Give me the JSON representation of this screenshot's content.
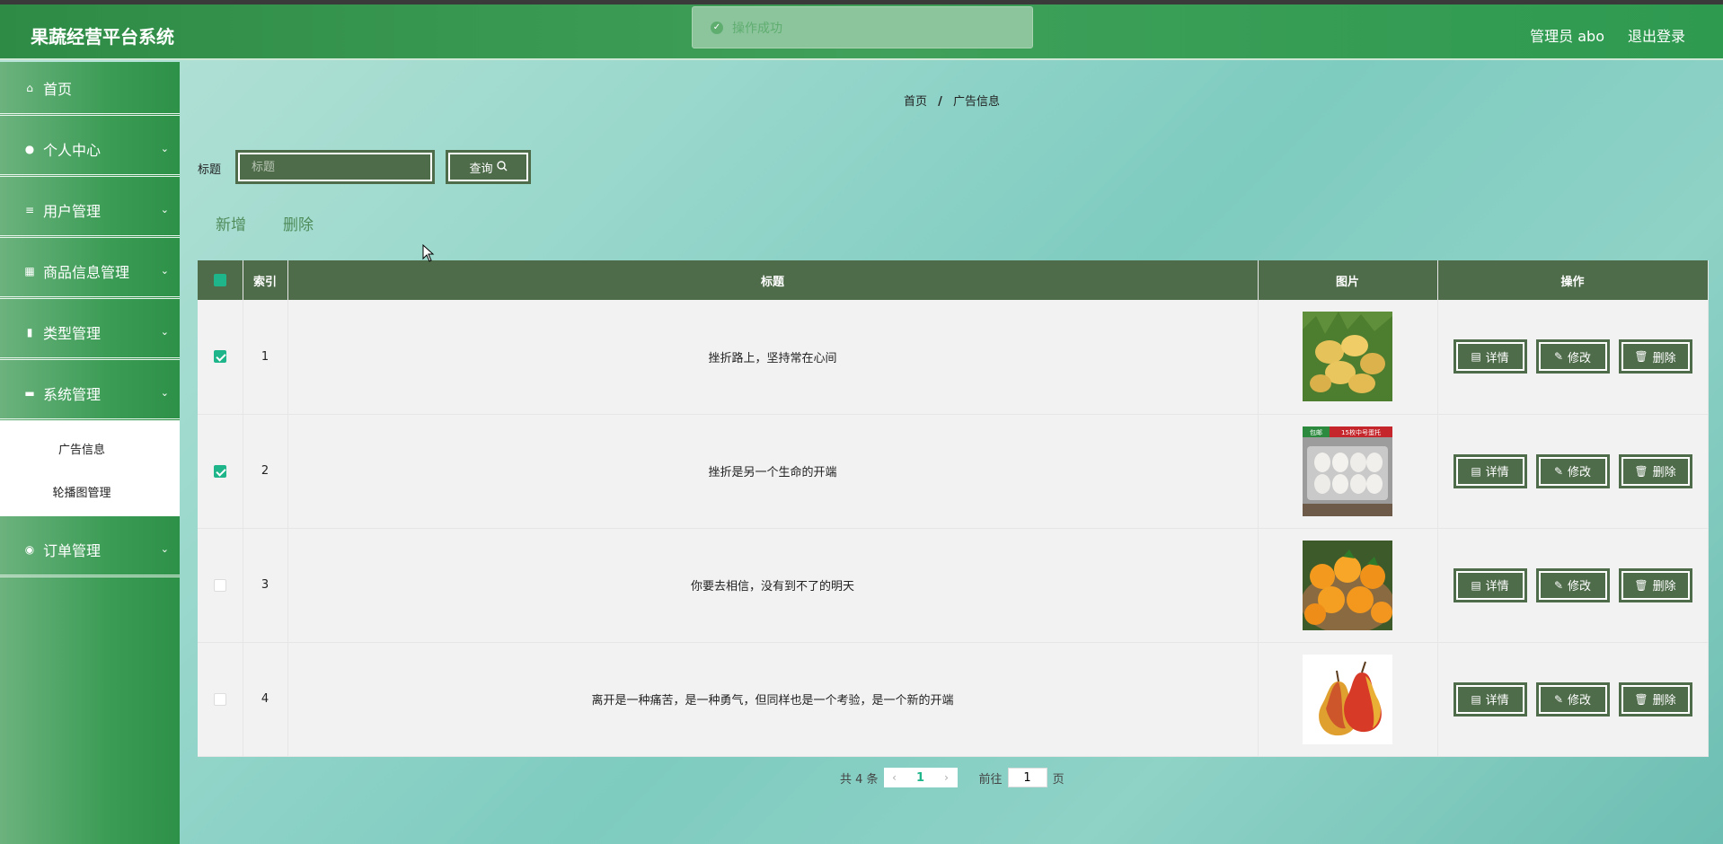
{
  "header": {
    "title": "果蔬经营平台系统",
    "user": "管理员 abo",
    "logout": "退出登录"
  },
  "toast": {
    "message": "操作成功"
  },
  "sidebar": {
    "items": [
      {
        "label": "首页",
        "icon": "home-icon"
      },
      {
        "label": "个人中心",
        "icon": "user-icon"
      },
      {
        "label": "用户管理",
        "icon": "list-icon"
      },
      {
        "label": "商品信息管理",
        "icon": "grid-icon"
      },
      {
        "label": "类型管理",
        "icon": "bar-chart-icon"
      },
      {
        "label": "系统管理",
        "icon": "monitor-icon"
      },
      {
        "label": "订单管理",
        "icon": "location-icon"
      }
    ],
    "sub_items": [
      "广告信息",
      "轮播图管理"
    ]
  },
  "breadcrumb": {
    "home": "首页",
    "sep": "/",
    "current": "广告信息"
  },
  "search": {
    "label": "标题",
    "placeholder": "标题",
    "button": "查询"
  },
  "actions": {
    "add": "新增",
    "delete": "删除"
  },
  "table": {
    "headers": [
      "索引",
      "标题",
      "图片",
      "操作"
    ],
    "rows": [
      {
        "index": "1",
        "title": "挫折路上，坚持常在心间",
        "image": "potatoes",
        "checked": true
      },
      {
        "index": "2",
        "title": "挫折是另一个生命的开端",
        "image": "eggs",
        "checked": true
      },
      {
        "index": "3",
        "title": "你要去相信，没有到不了的明天",
        "image": "oranges",
        "checked": false
      },
      {
        "index": "4",
        "title": "离开是一种痛苦，是一种勇气，但同样也是一个考验，是一个新的开端",
        "image": "pears",
        "checked": false
      }
    ],
    "op_labels": {
      "detail": "详情",
      "edit": "修改",
      "delete": "删除"
    },
    "egg_banner": {
      "left": "包邮",
      "right": "15枚中号蛋托"
    }
  },
  "pagination": {
    "total": "共 4 条",
    "current_page": "1",
    "goto_label": "前往",
    "goto_value": "1",
    "page_suffix": "页"
  },
  "colors": {
    "header": "#3a9a55",
    "button": "#4e6b4a",
    "accent": "#1fb58a"
  }
}
